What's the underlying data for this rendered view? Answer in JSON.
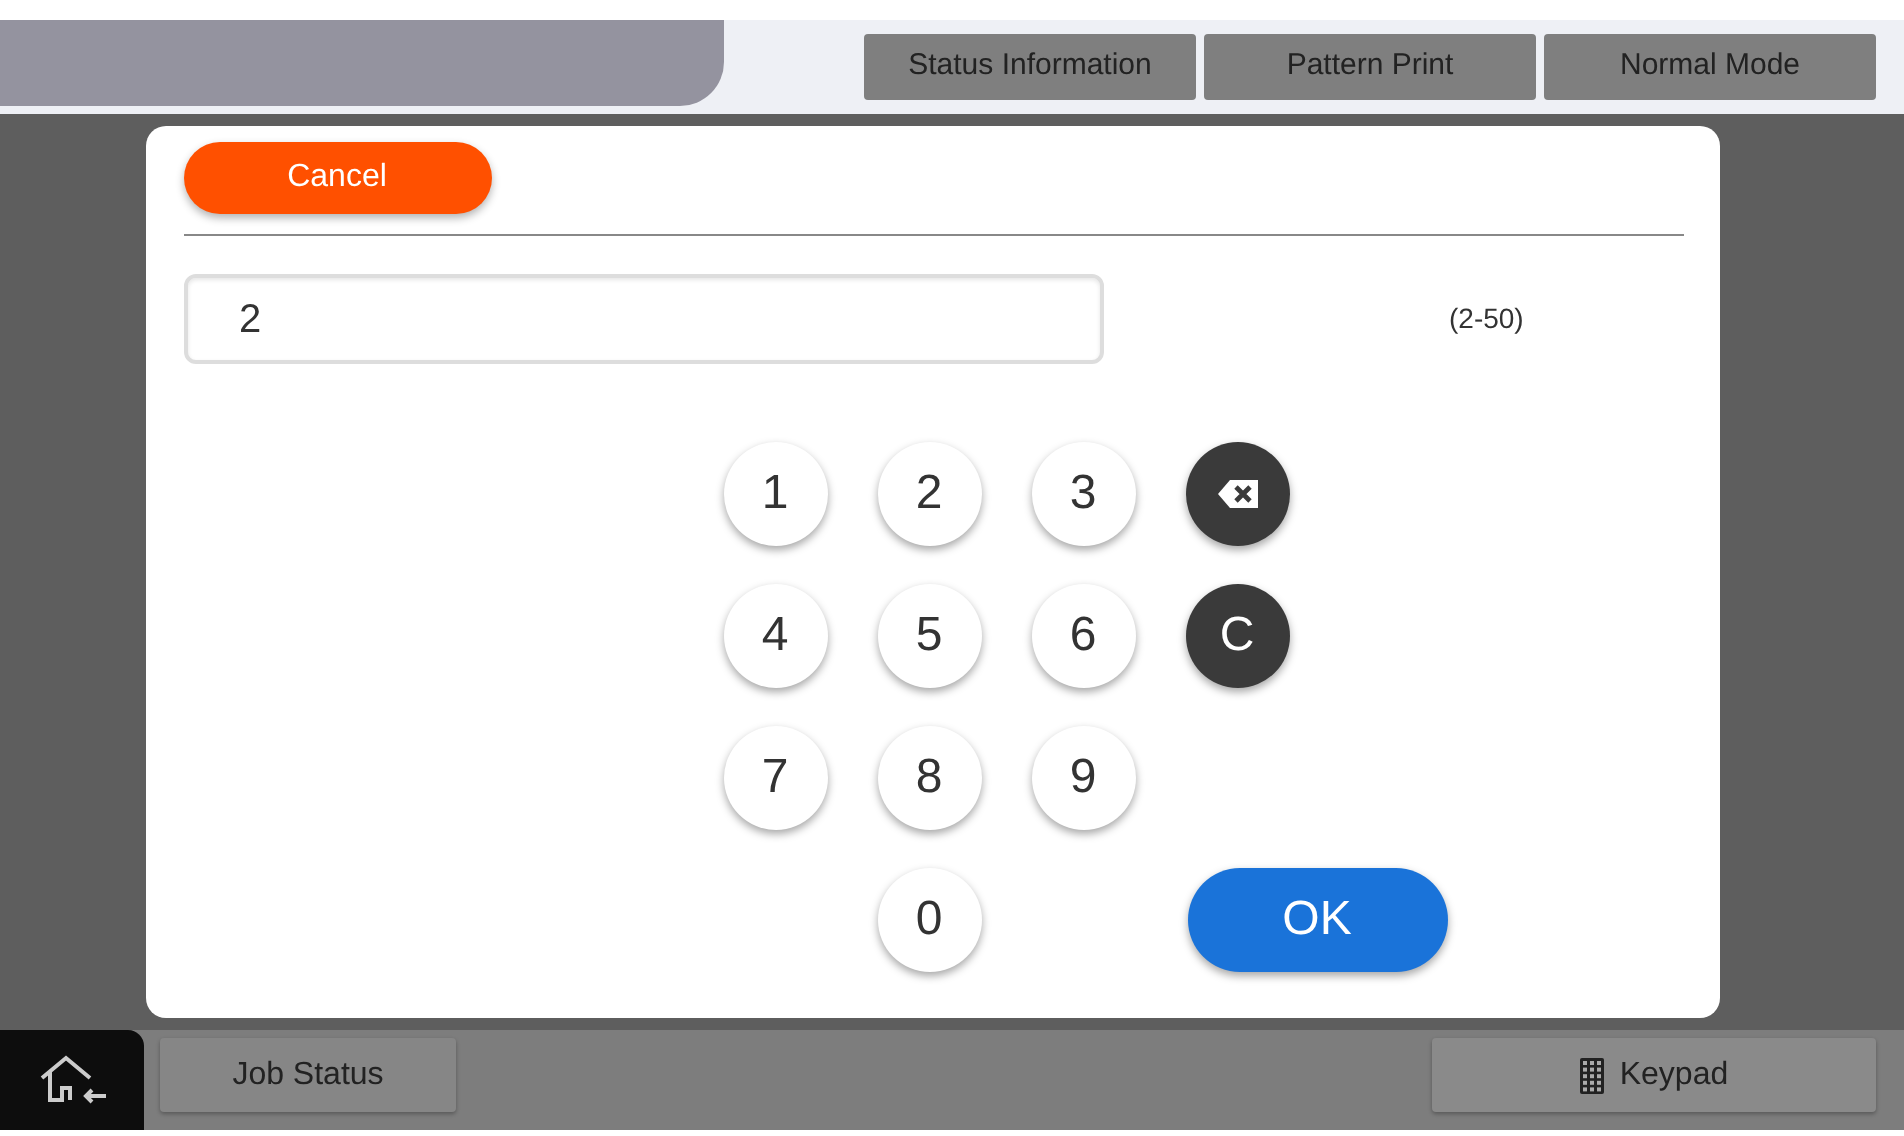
{
  "top_buttons": [
    "Status Information",
    "Pattern Print",
    "Normal Mode"
  ],
  "dialog": {
    "cancel": "Cancel",
    "value": "2",
    "range": "(2-50)",
    "keys": [
      {
        "kind": "digit",
        "label": "1"
      },
      {
        "kind": "digit",
        "label": "2"
      },
      {
        "kind": "digit",
        "label": "3"
      },
      {
        "kind": "backspace"
      },
      {
        "kind": "digit",
        "label": "4"
      },
      {
        "kind": "digit",
        "label": "5"
      },
      {
        "kind": "digit",
        "label": "6"
      },
      {
        "kind": "clear",
        "label": "C"
      },
      {
        "kind": "digit",
        "label": "7"
      },
      {
        "kind": "digit",
        "label": "8"
      },
      {
        "kind": "digit",
        "label": "9"
      },
      {
        "kind": "digit",
        "label": "0"
      },
      {
        "kind": "ok",
        "label": "OK"
      }
    ]
  },
  "bottom": {
    "job_status": "Job Status",
    "keypad": "Keypad"
  }
}
